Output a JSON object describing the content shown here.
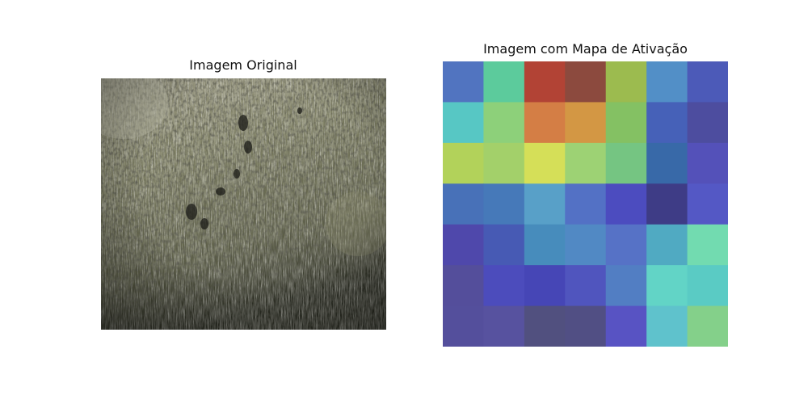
{
  "chart_data": [
    {
      "type": "image",
      "title": "Imagem Original"
    },
    {
      "type": "heatmap",
      "title": "Imagem com Mapa de Ativação",
      "rows": 7,
      "cols": 7,
      "colormap": "jet",
      "cell_colors": [
        [
          "#5174c0",
          "#5ccb9c",
          "#b24335",
          "#8c4a3e",
          "#9cbb4f",
          "#528fc7",
          "#4c5ab8"
        ],
        [
          "#57c7c4",
          "#8dd07a",
          "#d47e45",
          "#d39744",
          "#84c163",
          "#4661b8",
          "#4d4d9f"
        ],
        [
          "#b2d25a",
          "#a3d06a",
          "#d5df58",
          "#9dd274",
          "#75c582",
          "#3869a8",
          "#5451b9"
        ],
        [
          "#4871b8",
          "#4679b9",
          "#58a0c8",
          "#5371c5",
          "#4c4cbf",
          "#3e3c86",
          "#5458c5"
        ],
        [
          "#4f48ab",
          "#475ab4",
          "#478cbc",
          "#5189c4",
          "#5672c6",
          "#50aac2",
          "#72dbb0"
        ],
        [
          "#544e9b",
          "#4c4cbc",
          "#4646b6",
          "#5055be",
          "#527ec3",
          "#62d4c6",
          "#5acbc4"
        ],
        [
          "#544f9c",
          "#57529f",
          "#51507f",
          "#514f84",
          "#5853c3",
          "#5fc2cc",
          "#84d08a"
        ]
      ]
    }
  ]
}
